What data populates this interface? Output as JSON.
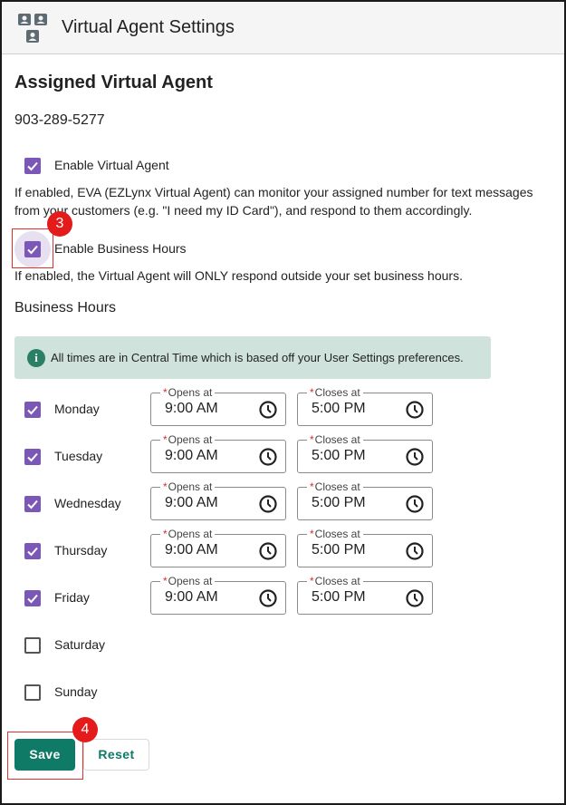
{
  "header": {
    "title": "Virtual Agent Settings",
    "icon": "chat-agents-icon"
  },
  "section": {
    "title": "Assigned Virtual Agent",
    "phone": "903-289-5277"
  },
  "enable_agent": {
    "checked": true,
    "label": "Enable Virtual Agent",
    "description": "If enabled, EVA (EZLynx Virtual Agent) can monitor your assigned number for text messages from your customers (e.g. \"I need my ID Card\"), and respond to them accordingly."
  },
  "enable_hours": {
    "checked": true,
    "label": "Enable Business Hours",
    "description": "If enabled, the Virtual Agent will ONLY respond outside your set business hours."
  },
  "business_hours": {
    "title": "Business Hours",
    "info": "All times are in Central Time which is based off your User Settings preferences.",
    "info_icon": "info-icon",
    "opens_label": "Opens at",
    "closes_label": "Closes at",
    "required_mark": "*",
    "days": [
      {
        "name": "Monday",
        "checked": true,
        "opens": "9:00 AM",
        "closes": "5:00 PM"
      },
      {
        "name": "Tuesday",
        "checked": true,
        "opens": "9:00 AM",
        "closes": "5:00 PM"
      },
      {
        "name": "Wednesday",
        "checked": true,
        "opens": "9:00 AM",
        "closes": "5:00 PM"
      },
      {
        "name": "Thursday",
        "checked": true,
        "opens": "9:00 AM",
        "closes": "5:00 PM"
      },
      {
        "name": "Friday",
        "checked": true,
        "opens": "9:00 AM",
        "closes": "5:00 PM"
      },
      {
        "name": "Saturday",
        "checked": false
      },
      {
        "name": "Sunday",
        "checked": false
      }
    ]
  },
  "annotations": {
    "step3": "3",
    "step4": "4"
  },
  "buttons": {
    "save": "Save",
    "reset": "Reset"
  },
  "colors": {
    "accent": "#7b57b8",
    "primary": "#0f7a66",
    "info_bg": "#cfe3dc",
    "annotation": "#e41b1b"
  }
}
